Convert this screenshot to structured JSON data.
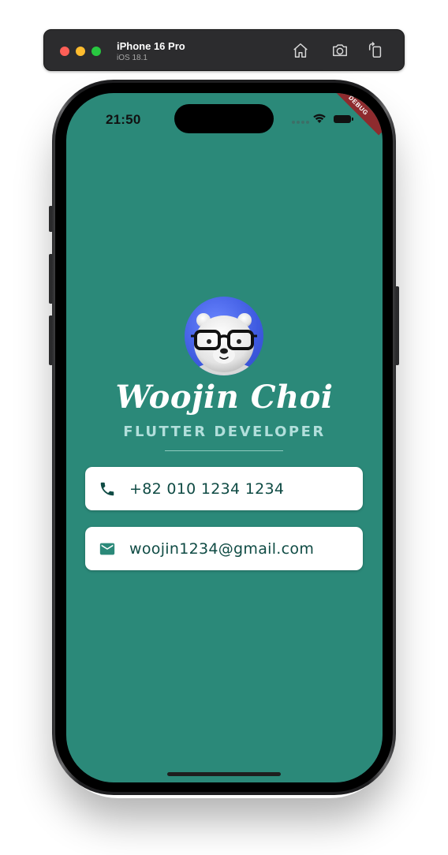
{
  "simulator": {
    "device_name": "iPhone 16 Pro",
    "os_version": "iOS 18.1",
    "buttons": [
      "home-button",
      "screenshot-button",
      "rotate-button"
    ]
  },
  "status_bar": {
    "time": "21:50",
    "debug_banner": "DEBUG"
  },
  "profile": {
    "name": "Woojin Choi",
    "title": "FLUTTER DEVELOPER",
    "avatar": "polar-bear-with-glasses"
  },
  "contacts": {
    "phone": {
      "icon": "phone-icon",
      "value": "+82 010 1234 1234"
    },
    "email": {
      "icon": "email-icon",
      "value": "woojin1234@gmail.com"
    }
  },
  "colors": {
    "background": "#2b8979",
    "card": "#ffffff",
    "card_text": "#0f4b44",
    "subtitle": "#b2dfdb",
    "debug_banner": "#8e2b2e"
  }
}
